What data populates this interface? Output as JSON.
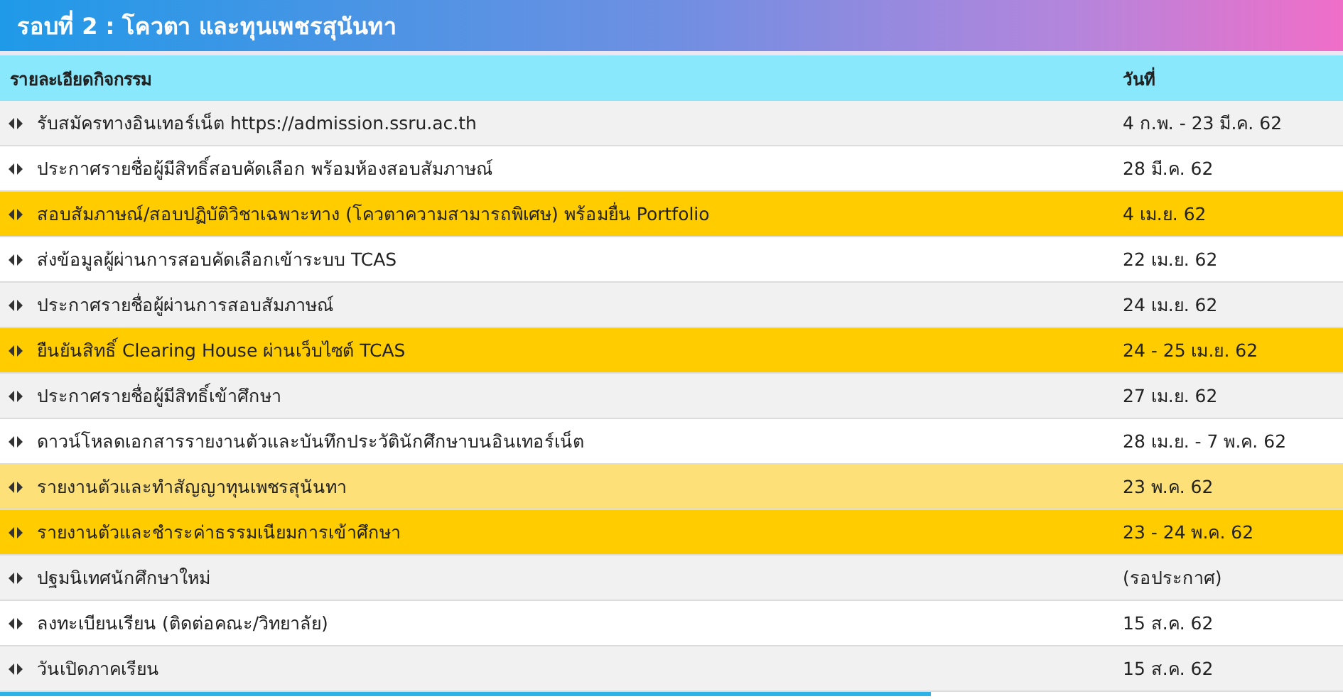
{
  "title": "รอบที่ 2 : โควตา และทุนเพชรสุนันทา",
  "table": {
    "columns": [
      "รายละเอียดกิจกรรม",
      "วันที่"
    ],
    "rows": [
      {
        "activity": "รับสมัครทางอินเทอร์เน็ต https://admission.ssru.ac.th",
        "date": "4 ก.พ. - 23 มี.ค. 62",
        "kind": "plain"
      },
      {
        "activity": "ประกาศรายชื่อผู้มีสิทธิ์สอบคัดเลือก พร้อมห้องสอบสัมภาษณ์",
        "date": "28 มี.ค. 62",
        "kind": "plain"
      },
      {
        "activity": "สอบสัมภาษณ์/สอบปฏิบัติวิชาเฉพาะทาง (โควตาความสามารถพิเศษ) พร้อมยื่น Portfolio",
        "date": "4 เม.ย. 62",
        "kind": "highlight"
      },
      {
        "activity": "ส่งข้อมูลผู้ผ่านการสอบคัดเลือกเข้าระบบ TCAS",
        "date": "22 เม.ย. 62",
        "kind": "plain"
      },
      {
        "activity": "ประกาศรายชื่อผู้ผ่านการสอบสัมภาษณ์",
        "date": "24 เม.ย. 62",
        "kind": "plain"
      },
      {
        "activity": "ยืนยันสิทธิ์ Clearing House ผ่านเว็บไซต์ TCAS",
        "date": "24 - 25 เม.ย. 62",
        "kind": "highlight"
      },
      {
        "activity": "ประกาศรายชื่อผู้มีสิทธิ์เข้าศึกษา",
        "date": "27 เม.ย. 62",
        "kind": "plain"
      },
      {
        "activity": "ดาวน์โหลดเอกสารรายงานตัวและบันทึกประวัตินักศึกษาบนอินเทอร์เน็ต",
        "date": "28 เม.ย. - 7 พ.ค. 62",
        "kind": "plain"
      },
      {
        "activity": "รายงานตัวและทำสัญญาทุนเพชรสุนันทา",
        "date": "23 พ.ค. 62",
        "kind": "soft"
      },
      {
        "activity": "รายงานตัวและชำระค่าธรรมเนียมการเข้าศึกษา",
        "date": "23 - 24 พ.ค. 62",
        "kind": "highlight"
      },
      {
        "activity": "ปฐมนิเทศนักศึกษาใหม่",
        "date": "(รอประกาศ)",
        "kind": "plain"
      },
      {
        "activity": "ลงทะเบียนเรียน (ติดต่อคณะ/วิทยาลัย)",
        "date": "15 ส.ค. 62",
        "kind": "plain"
      },
      {
        "activity": "วันเปิดภาคเรียน",
        "date": "15 ส.ค. 62",
        "kind": "plain"
      }
    ]
  }
}
